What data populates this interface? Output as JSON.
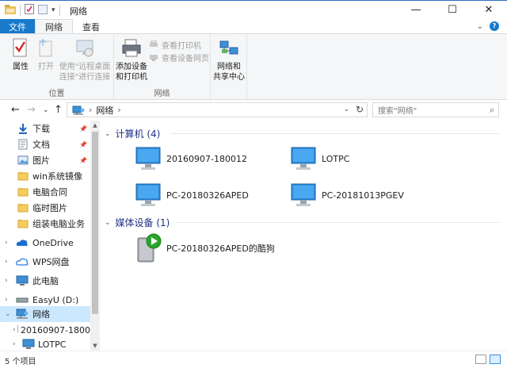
{
  "window": {
    "title": "网络",
    "minimize": "—",
    "maximize": "☐",
    "close": "✕"
  },
  "ribbon_tabs": [
    "文件",
    "网络",
    "查看"
  ],
  "ribbon": {
    "location": {
      "label": "位置",
      "properties": "属性",
      "open": "打开",
      "use_remote_1": "使用\"远程桌面",
      "use_remote_2": "连接\"进行连接"
    },
    "network": {
      "label": "网络",
      "add_device_1": "添加设备",
      "add_device_2": "和打印机",
      "view_printers": "查看打印机",
      "view_device_page": "查看设备网页",
      "network_center_1": "网络和",
      "network_center_2": "共享中心"
    }
  },
  "address": {
    "path": "网络",
    "separator": "›",
    "search_placeholder": "搜索\"网络\""
  },
  "nav": {
    "items": [
      {
        "label": "下载",
        "icon": "download-icon",
        "pinned": true
      },
      {
        "label": "文档",
        "icon": "document-icon",
        "pinned": true
      },
      {
        "label": "图片",
        "icon": "pictures-icon",
        "pinned": true
      },
      {
        "label": "win系统镜像",
        "icon": "folder-icon"
      },
      {
        "label": "电脑合同",
        "icon": "folder-icon"
      },
      {
        "label": "临时图片",
        "icon": "folder-icon"
      },
      {
        "label": "组装电脑业务",
        "icon": "folder-icon"
      },
      {
        "label": "OneDrive",
        "icon": "cloud-icon"
      },
      {
        "label": "WPS网盘",
        "icon": "wps-icon"
      },
      {
        "label": "此电脑",
        "icon": "computer-icon"
      },
      {
        "label": "EasyU (D:)",
        "icon": "drive-icon"
      },
      {
        "label": "网络",
        "icon": "network-icon",
        "selected": true
      },
      {
        "label": "20160907-1800",
        "icon": "monitor-icon"
      },
      {
        "label": "LOTPC",
        "icon": "monitor-icon"
      }
    ]
  },
  "groups": {
    "computers": {
      "title": "计算机 (4)",
      "items": [
        "20160907-180012",
        "LOTPC",
        "PC-20180326APED",
        "PC-20181013PGEV"
      ]
    },
    "media": {
      "title": "媒体设备 (1)",
      "items": [
        "PC-20180326APED的酷狗"
      ]
    }
  },
  "status": {
    "count": "5 个项目"
  },
  "colors": {
    "accent": "#1979ca",
    "group_header": "#1e3287",
    "selection": "#cce8ff"
  }
}
